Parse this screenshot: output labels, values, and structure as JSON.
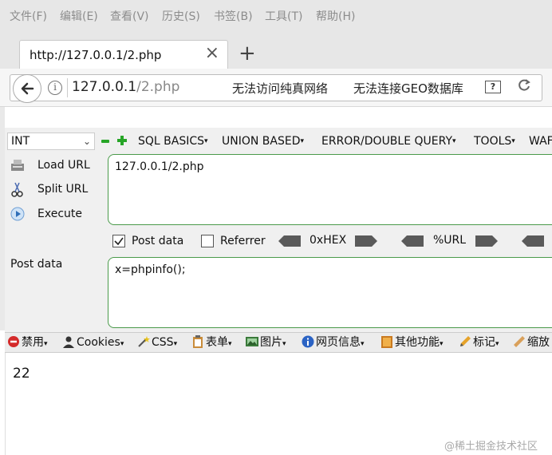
{
  "menu": [
    "文件(F)",
    "编辑(E)",
    "查看(V)",
    "历史(S)",
    "书签(B)",
    "工具(T)",
    "帮助(H)"
  ],
  "tab": {
    "title": "http://127.0.0.1/2.php",
    "close": "×",
    "new_tab": "+"
  },
  "nav": {
    "url_host": "127.0.0.1",
    "url_path": "/2.php",
    "message1": "无法访问纯真网络",
    "message2": "无法连接GEO数据库",
    "help": "?"
  },
  "hackbar": {
    "select_value": "INT",
    "menus": [
      "SQL BASICS",
      "UNION BASED",
      "ERROR/DOUBLE QUERY",
      "TOOLS",
      "WAF"
    ],
    "load_url": "Load URL",
    "split_url": "Split URL",
    "execute": "Execute",
    "url_value": "127.0.0.1/2.php",
    "post_data_check": "Post data",
    "referrer_check": "Referrer",
    "hex_label": "0xHEX",
    "url_label": "%URL",
    "post_data_label": "Post data",
    "post_value": "x=phpinfo();"
  },
  "webdev": [
    "禁用",
    "Cookies",
    "CSS",
    "表单",
    "图片",
    "网页信息",
    "其他功能",
    "标记",
    "缩放"
  ],
  "page": {
    "output": "22"
  },
  "watermark": "@稀土掘金技术社区",
  "colors": {
    "accent_green": "#27a527",
    "border_green": "#4a9a4a"
  }
}
